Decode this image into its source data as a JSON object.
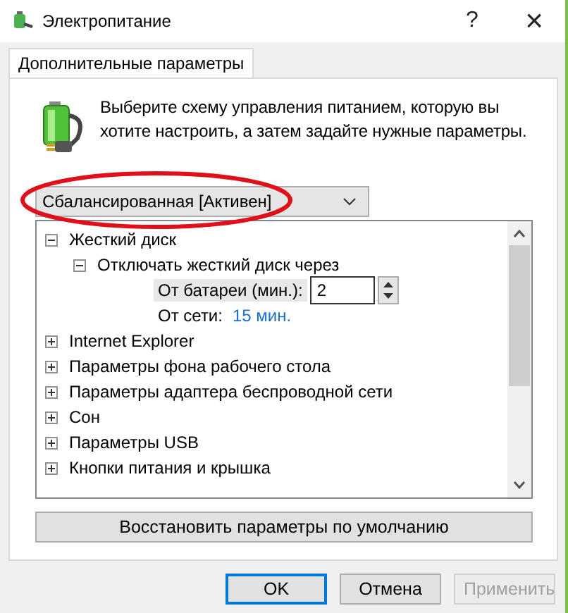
{
  "window": {
    "title": "Электропитание",
    "help": "?",
    "close": "×"
  },
  "tabs": [
    {
      "label": "Дополнительные параметры",
      "selected": true
    }
  ],
  "intro": "Выберите схему управления питанием, которую вы хотите настроить, а затем задайте нужные параметры.",
  "scheme": {
    "value": "Сбалансированная [Активен]",
    "highlighted": true
  },
  "tree": {
    "items": [
      {
        "kind": "group",
        "label": "Жесткий диск",
        "expanded": true,
        "children": [
          {
            "kind": "group",
            "label": "Отключать жесткий диск через",
            "expanded": true,
            "children": [
              {
                "kind": "spin",
                "label": "От батареи (мин.):",
                "value": "2",
                "selected": true
              },
              {
                "kind": "value",
                "label": "От сети:",
                "value": "15 мин.",
                "selected": false
              }
            ]
          }
        ]
      },
      {
        "kind": "group",
        "label": "Internet Explorer",
        "expanded": false
      },
      {
        "kind": "group",
        "label": "Параметры фона рабочего стола",
        "expanded": false
      },
      {
        "kind": "group",
        "label": "Параметры адаптера беспроводной сети",
        "expanded": false
      },
      {
        "kind": "group",
        "label": "Сон",
        "expanded": false
      },
      {
        "kind": "group",
        "label": "Параметры USB",
        "expanded": false
      },
      {
        "kind": "group",
        "label": "Кнопки питания и крышка",
        "expanded": false
      }
    ]
  },
  "restore_button": "Восстановить параметры по умолчанию",
  "buttons": [
    {
      "label": "OK",
      "kind": "default",
      "disabled": false
    },
    {
      "label": "Отмена",
      "kind": "normal",
      "disabled": false
    },
    {
      "label": "Применить",
      "kind": "normal",
      "disabled": true
    }
  ]
}
